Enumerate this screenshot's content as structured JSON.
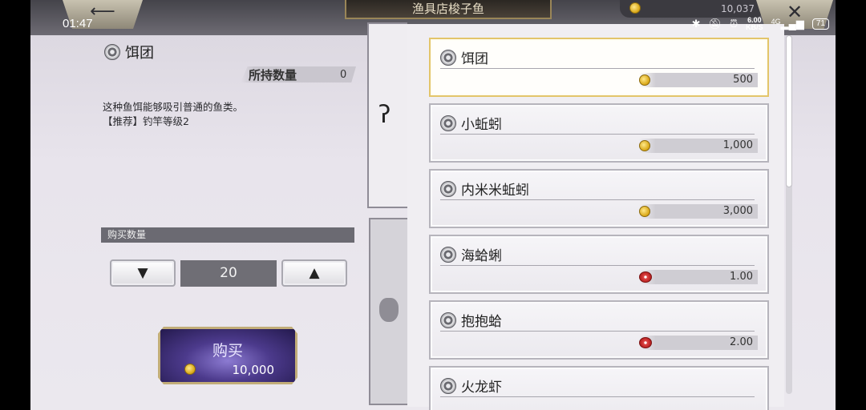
{
  "status_bar": {
    "time": "01:47",
    "net_speed_value": "6.00",
    "net_speed_unit": "KB/S",
    "network": "4G",
    "battery": "71"
  },
  "header": {
    "title": "渔具店梭子鱼",
    "coin_balance": "10,037",
    "back_icon": "back-arrow-icon",
    "close_icon": "close-icon"
  },
  "detail": {
    "name": "饵团",
    "owned_label": "所持数量",
    "owned_value": "0",
    "description_line1": "这种鱼饵能够吸引普通的鱼类。",
    "description_line2": "【推荐】钓竿等级2",
    "qty_header": "购买数量",
    "qty_value": "20",
    "decrease_glyph": "▼",
    "increase_glyph": "▲",
    "buy_label": "购买",
    "buy_price": "10,000"
  },
  "tabs": {
    "hook_glyph": "ʔ",
    "tab_icons": [
      "hook-icon",
      "bag-icon"
    ]
  },
  "items": [
    {
      "name": "饵团",
      "price": "500",
      "currency": "coin",
      "selected": true
    },
    {
      "name": "小蚯蚓",
      "price": "1,000",
      "currency": "coin",
      "selected": false
    },
    {
      "name": "内米米蚯蚓",
      "price": "3,000",
      "currency": "coin",
      "selected": false
    },
    {
      "name": "海蛤蜊",
      "price": "1.00",
      "currency": "gem",
      "selected": false
    },
    {
      "name": "抱抱蛤",
      "price": "2.00",
      "currency": "gem",
      "selected": false
    },
    {
      "name": "火龙虾",
      "price": "",
      "currency": "gem",
      "selected": false
    }
  ],
  "colors": {
    "selected_border": "#e3c56a",
    "coin": "#d8a513",
    "gem": "#e14a4a",
    "buy_button": "#4c3a8c"
  }
}
